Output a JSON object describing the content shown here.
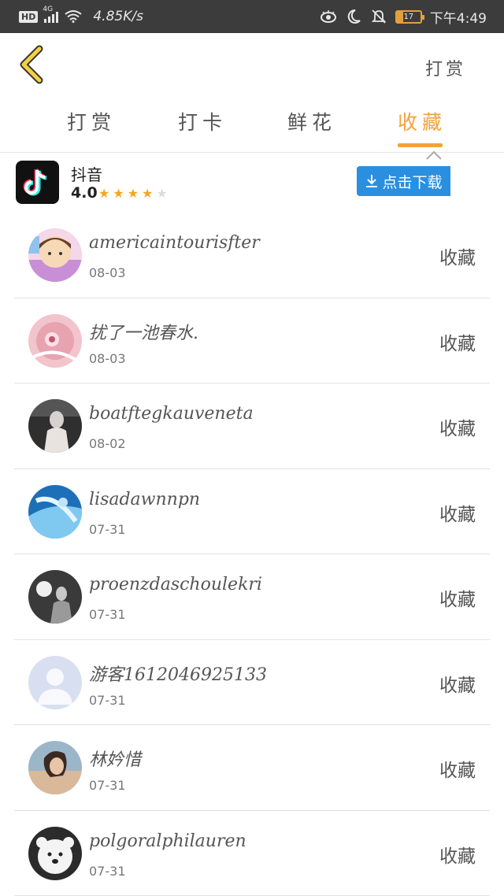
{
  "status_bar": {
    "hd": "HD",
    "network": "4G",
    "speed": "4.85K/s",
    "battery": "17",
    "time": "下午4:49"
  },
  "header": {
    "back_icon": "chevron-left-icon",
    "right_label": "打赏"
  },
  "tabs": [
    {
      "label": "打赏",
      "active": false
    },
    {
      "label": "打卡",
      "active": false
    },
    {
      "label": "鲜花",
      "active": false
    },
    {
      "label": "收藏",
      "active": true
    }
  ],
  "ad": {
    "app_name": "抖音",
    "rating": "4.0",
    "stars_filled": 4,
    "stars_total": 5,
    "download_label": "点击下载"
  },
  "list": [
    {
      "name": "americaintourisfter",
      "date": "08-03",
      "action": "收藏"
    },
    {
      "name": "扰了一池春水.",
      "date": "08-03",
      "action": "收藏"
    },
    {
      "name": "boatftegkauveneta",
      "date": "08-02",
      "action": "收藏"
    },
    {
      "name": "lisadawnnpn",
      "date": "07-31",
      "action": "收藏"
    },
    {
      "name": "proenzdaschoulekri",
      "date": "07-31",
      "action": "收藏"
    },
    {
      "name": "游客1612046925133",
      "date": "07-31",
      "action": "收藏"
    },
    {
      "name": "林妗惜",
      "date": "07-31",
      "action": "收藏"
    },
    {
      "name": "polgoralphilauren",
      "date": "07-31",
      "action": "收藏"
    }
  ],
  "colors": {
    "accent": "#f2a23c",
    "statusbar": "#3c3c3c",
    "download": "#2b8fe0"
  }
}
